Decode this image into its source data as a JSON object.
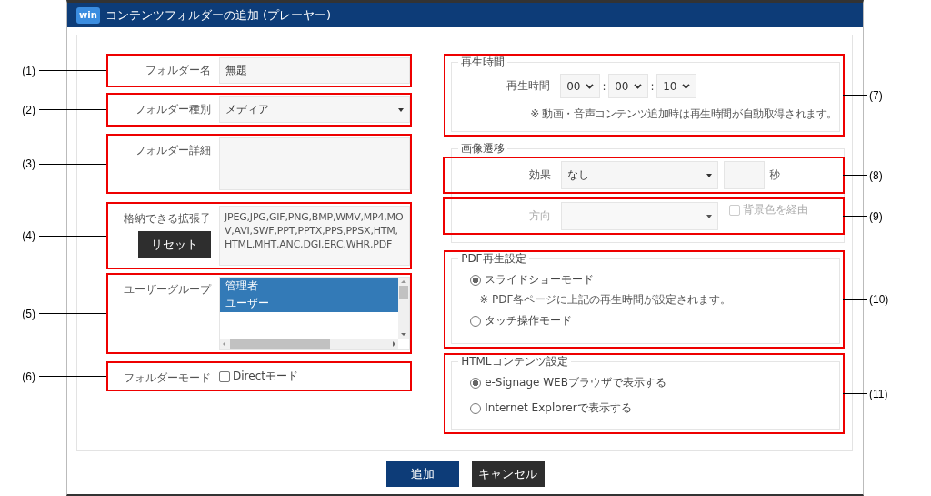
{
  "window": {
    "logo": "win",
    "title": "コンテンツフォルダーの追加 (プレーヤー)"
  },
  "left_fields": [
    {
      "kind": "text",
      "callout": "(1)",
      "label": "フォルダー名",
      "value": "無題"
    },
    {
      "kind": "select",
      "callout": "(2)",
      "label": "フォルダー種別",
      "value": "メディア"
    },
    {
      "kind": "textarea",
      "callout": "(3)",
      "label": "フォルダー詳細"
    },
    {
      "kind": "extensions",
      "callout": "(4)",
      "label": "格納できる拡張子",
      "button": "リセット",
      "value": "JPEG,JPG,GIF,PNG,BMP,WMV,MP4,MOV,AVI,SWF,PPT,PPTX,PPS,PPSX,HTM,HTML,MHT,ANC,DGI,ERC,WHR,PDF"
    },
    {
      "kind": "listbox",
      "callout": "(5)",
      "label": "ユーザーグループ",
      "items": [
        {
          "text": "管理者",
          "selected": true
        },
        {
          "text": "ユーザー",
          "selected": true
        }
      ]
    },
    {
      "kind": "checkbox",
      "callout": "(6)",
      "label": "フォルダーモード",
      "option": "Directモード",
      "checked": false
    }
  ],
  "playback": {
    "callout": "(7)",
    "legend": "再生時間",
    "label": "再生時間",
    "hours": "00",
    "minutes": "00",
    "seconds": "10",
    "separator": ":",
    "note": "※ 動画・音声コンテンツ追加時は再生時間が自動取得されます。"
  },
  "transition": {
    "legend": "画像遷移",
    "effect": {
      "callout": "(8)",
      "label": "効果",
      "value": "なし",
      "unit": "秒"
    },
    "direction": {
      "callout": "(9)",
      "label": "方向",
      "disabled": true,
      "option": "背景色を経由",
      "checked": false
    }
  },
  "pdf": {
    "callout": "(10)",
    "legend": "PDF再生設定",
    "options": [
      {
        "label": "スライドショーモード",
        "selected": true,
        "note": "※ PDF各ページに上記の再生時間が設定されます。"
      },
      {
        "label": "タッチ操作モード",
        "selected": false
      }
    ]
  },
  "html": {
    "callout": "(11)",
    "legend": "HTMLコンテンツ設定",
    "options": [
      {
        "label": "e-Signage WEBブラウザで表示する",
        "selected": true
      },
      {
        "label": "Internet Explorerで表示する",
        "selected": false
      }
    ]
  },
  "buttons": [
    {
      "label": "追加",
      "kind": "primary"
    },
    {
      "label": "キャンセル",
      "kind": "secondary"
    }
  ]
}
